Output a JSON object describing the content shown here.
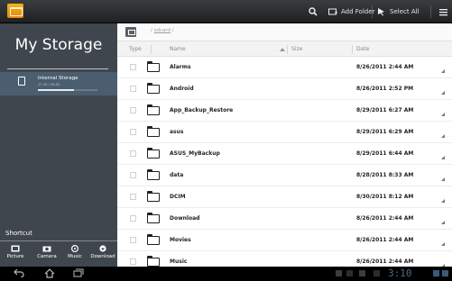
{
  "toolbar": {
    "add_folder_label": "Add Folder",
    "select_all_label": "Select All"
  },
  "sidebar": {
    "title": "My Storage",
    "storage": {
      "name": "Internal Storage",
      "sub": "17.4G / 28.8G",
      "usage_fraction": 0.6
    },
    "shortcut_label": "Shortcut",
    "shortcuts": [
      {
        "label": "Picture",
        "icon": "picture-icon"
      },
      {
        "label": "Camera",
        "icon": "camera-icon"
      },
      {
        "label": "Music",
        "icon": "music-icon"
      },
      {
        "label": "Download",
        "icon": "download-icon"
      }
    ]
  },
  "path": {
    "prefix": "/ ",
    "link": "sdcard",
    "suffix": " /"
  },
  "columns": {
    "type": "Type",
    "name": "Name",
    "size": "Size",
    "date": "Date"
  },
  "files": [
    {
      "name": "Alarms",
      "date": "8/26/2011 2:44 AM"
    },
    {
      "name": "Android",
      "date": "8/26/2011 2:52 PM"
    },
    {
      "name": "App_Backup_Restore",
      "date": "8/29/2011 6:27 AM"
    },
    {
      "name": "asus",
      "date": "8/29/2011 6:29 AM"
    },
    {
      "name": "ASUS_MyBackup",
      "date": "8/29/2011 6:44 AM"
    },
    {
      "name": "data",
      "date": "8/28/2011 8:33 AM"
    },
    {
      "name": "DCIM",
      "date": "8/30/2011 8:12 AM"
    },
    {
      "name": "Download",
      "date": "8/26/2011 2:44 AM"
    },
    {
      "name": "Movies",
      "date": "8/26/2011 2:44 AM"
    },
    {
      "name": "Music",
      "date": "8/26/2011 2:44 AM"
    }
  ],
  "system": {
    "clock": "3:10"
  },
  "colors": {
    "sidebar_bg": "#3f464d",
    "selected_storage_bg": "#4b5e6f",
    "app_icon_orange": "#f8b21a",
    "clock_blue": "#4d6a8a"
  }
}
